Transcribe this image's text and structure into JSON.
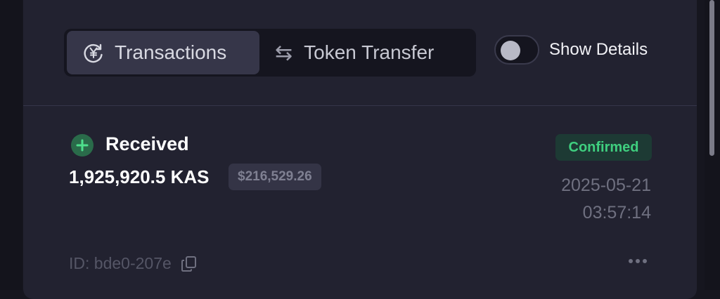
{
  "tabs": [
    {
      "label": "Transactions",
      "icon": "yen-exchange-icon",
      "active": true
    },
    {
      "label": "Token Transfer",
      "icon": "swap-arrows-icon",
      "active": false
    }
  ],
  "toggle": {
    "label": "Show Details",
    "checked": false
  },
  "transaction": {
    "type": "Received",
    "amount": "1,925,920.5 KAS",
    "usd_value": "$216,529.26",
    "status": "Confirmed",
    "date": "2025-05-21",
    "time": "03:57:14",
    "id": "ID: bde0-207e"
  },
  "colors": {
    "background": "#16161f",
    "card": "#222230",
    "accent_green": "#3fcf7f",
    "muted_text": "#6f7080"
  }
}
